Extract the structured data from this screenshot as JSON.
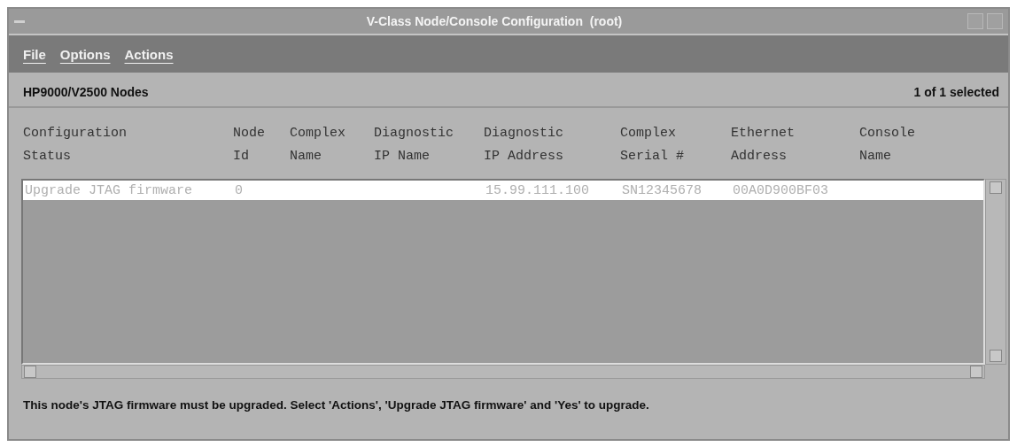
{
  "window": {
    "title": "V-Class Node/Console Configuration  (root)"
  },
  "menu": [
    "File",
    "Options",
    "Actions"
  ],
  "header": {
    "title": "HP9000/V2500 Nodes",
    "selection": "1 of 1 selected"
  },
  "table": {
    "columns": [
      "Configuration\nStatus",
      "Node\nId",
      "Complex\nName",
      "Diagnostic\nIP Name",
      "Diagnostic\nIP Address",
      "Complex\nSerial #",
      "Ethernet\nAddress",
      "Console\nName"
    ],
    "rows": [
      {
        "selected": true,
        "cells": [
          "Upgrade JTAG firmware",
          "0",
          "",
          "",
          "15.99.111.100",
          "SN12345678",
          "00A0D900BF03",
          ""
        ]
      }
    ]
  },
  "message": "This node's JTAG firmware must be upgraded. Select 'Actions', 'Upgrade JTAG firmware' and 'Yes' to upgrade."
}
